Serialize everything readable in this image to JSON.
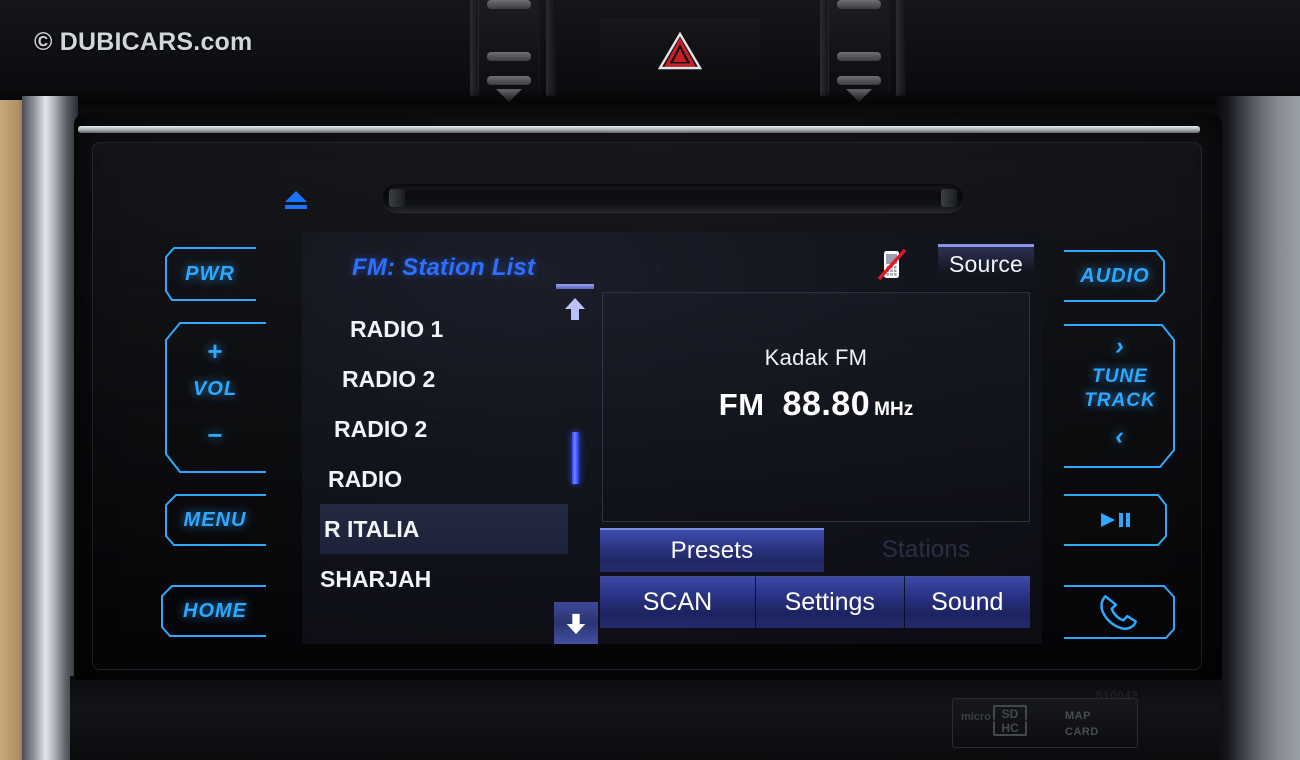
{
  "watermark": "© DUBICARS.com",
  "screen": {
    "title": "FM: Station List",
    "source_button": "Source",
    "phone_icon": "phone-disconnected-icon",
    "station_list": [
      {
        "label": "RADIO 1",
        "selected": false,
        "indent": 30
      },
      {
        "label": "RADIO 2",
        "selected": false,
        "indent": 22
      },
      {
        "label": "RADIO 2",
        "selected": false,
        "indent": 14
      },
      {
        "label": "RADIO",
        "selected": false,
        "indent": 8
      },
      {
        "label": "R ITALIA",
        "selected": true,
        "indent": 4
      },
      {
        "label": "SHARJAH",
        "selected": false,
        "indent": 0
      }
    ],
    "scroll": {
      "up_icon": "arrow-up-icon",
      "down_icon": "arrow-down-icon"
    },
    "now_playing": {
      "station_name": "Kadak FM",
      "band": "FM",
      "frequency": "88.80",
      "unit": "MHz"
    },
    "tabs": [
      {
        "label": "Presets",
        "active": true
      },
      {
        "label": "Stations",
        "active": false
      }
    ],
    "bottom_buttons": [
      {
        "label": "SCAN"
      },
      {
        "label": "Settings"
      },
      {
        "label": "Sound"
      }
    ]
  },
  "hardware": {
    "eject_icon": "eject-icon",
    "left_buttons": [
      {
        "label": "PWR"
      },
      {
        "label": "VOL",
        "plus": "+",
        "minus": "−"
      },
      {
        "label": "MENU"
      },
      {
        "label": "HOME"
      }
    ],
    "right_buttons": [
      {
        "label": "AUDIO"
      },
      {
        "label_line1": "TUNE",
        "label_line2": "TRACK",
        "next": "›",
        "prev": "‹"
      },
      {
        "icon": "play-pause-icon"
      },
      {
        "icon": "phone-icon"
      }
    ],
    "sd_card": {
      "brand": "micro",
      "sd_mark": "SD",
      "hc_mark": "HC",
      "label_line1": "MAP",
      "label_line2": "CARD"
    },
    "part_number": "510042"
  },
  "colors": {
    "accent_blue": "#2fa8ff",
    "ui_blue": "#2f6fff",
    "button_blue": "#2c3684",
    "text_white": "#f2f4f8",
    "screen_bg": "#12141c",
    "hazard_red": "#c8202a"
  }
}
